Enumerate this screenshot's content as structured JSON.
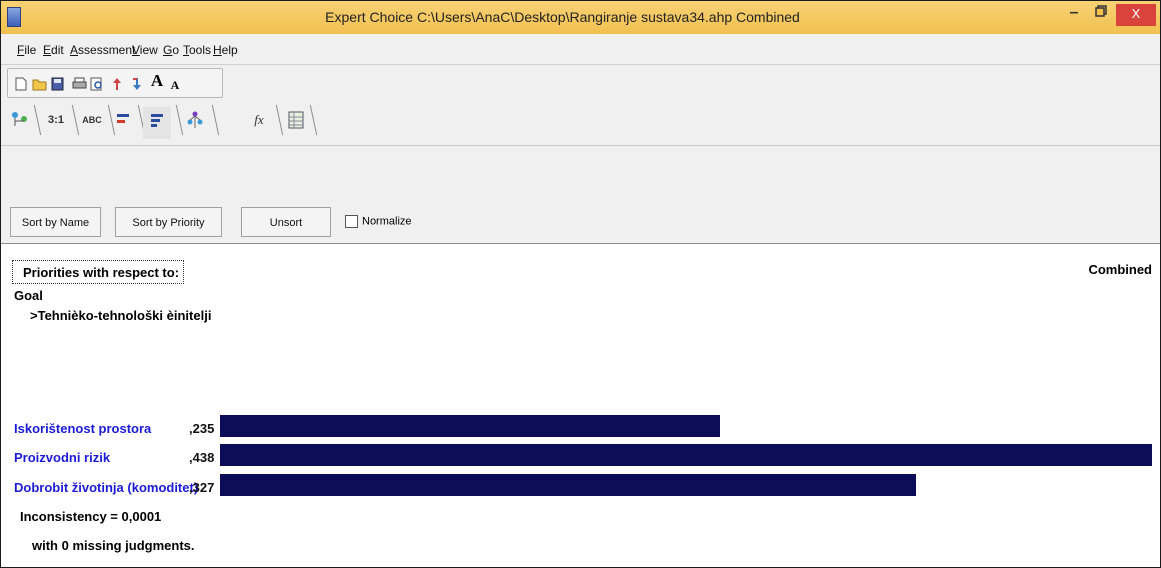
{
  "window": {
    "title": "Expert Choice    C:\\Users\\AnaC\\Desktop\\Rangiranje sustava34.ahp   Combined",
    "minimize_glyph": "–",
    "maximize_glyph": "🗗",
    "close_glyph": "X"
  },
  "menu": [
    {
      "label": "File"
    },
    {
      "label": "Edit"
    },
    {
      "label": "Assessment"
    },
    {
      "label": "View"
    },
    {
      "label": "Go"
    },
    {
      "label": "Tools"
    },
    {
      "label": "Help"
    }
  ],
  "toolbar": {
    "icons": [
      "new-file-icon",
      "open-folder-icon",
      "save-icon",
      "print-icon",
      "print-preview-icon",
      "move-up-icon",
      "move-down-icon",
      "font-larger-icon",
      "font-smaller-icon"
    ],
    "font_larger_glyph": "A",
    "font_smaller_glyph": "A"
  },
  "tabs": [
    {
      "label": "",
      "icon": "model-tree-icon"
    },
    {
      "label": "3:1",
      "icon": "numerical-comparison-icon"
    },
    {
      "label": "ABC",
      "icon": "verbal-comparison-icon"
    },
    {
      "label": "",
      "icon": "graphical-comparison-icon"
    },
    {
      "label": "",
      "icon": "priorities-icon"
    },
    {
      "label": "",
      "icon": "hierarchy-icon"
    },
    {
      "label": "fx",
      "icon": "formula-icon"
    },
    {
      "label": "",
      "icon": "data-grid-icon"
    }
  ],
  "buttons": {
    "sort_by_name": "Sort by Name",
    "sort_by_priority": "Sort by Priority",
    "unsort": "Unsort",
    "normalize": "Normalize"
  },
  "content": {
    "priorities_heading": "Priorities with respect to:",
    "combined": "Combined",
    "goal": "Goal",
    "goal_sub": ">Tehnièko-tehnološki èinitelji",
    "accent_color": "#0c0c58",
    "label_color": "#1b1bd6",
    "rows": [
      {
        "label": "Iskorištenost prostora",
        "value": ",235",
        "priority": 0.235
      },
      {
        "label": "Proizvodni rizik",
        "value": ",438",
        "priority": 0.438
      },
      {
        "label": "Dobrobit životinja (komoditet)",
        "value": ",327",
        "priority": 0.327
      }
    ],
    "inconsistency": "Inconsistency = 0,0001",
    "missing": "with 0  missing judgments."
  }
}
